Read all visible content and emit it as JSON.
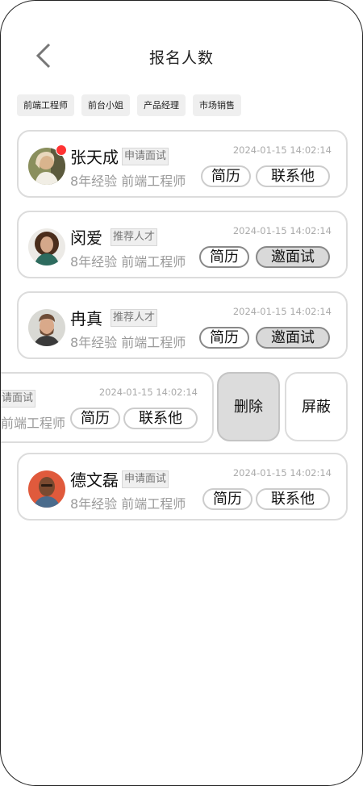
{
  "header": {
    "title": "报名人数"
  },
  "filters": [
    "前端工程师",
    "前台小姐",
    "产品经理",
    "市场销售"
  ],
  "candidates": [
    {
      "name": "张天成",
      "tag": "申请面试",
      "time": "2024-01-15 14:02:14",
      "meta": "8年经验  前端工程师",
      "btn1": "简历",
      "btn2": "联系他",
      "unread": true
    },
    {
      "name": "闵爱",
      "tag": "推荐人才",
      "time": "2024-01-15 14:02:14",
      "meta": "8年经验  前端工程师",
      "btn1": "简历",
      "btn2": "邀面试",
      "unread": false
    },
    {
      "name": "冉真",
      "tag": "推荐人才",
      "time": "2024-01-15 14:02:14",
      "meta": "8年经验  前端工程师",
      "btn1": "简历",
      "btn2": "邀面试",
      "unread": false
    },
    {
      "name": "",
      "tag": "请面试",
      "time": "2024-01-15 14:02:14",
      "meta": "前端工程师",
      "btn1": "简历",
      "btn2": "联系他",
      "unread": false
    },
    {
      "name": "德文磊",
      "tag": "申请面试",
      "time": "2024-01-15 14:02:14",
      "meta": "8年经验  前端工程师",
      "btn1": "简历",
      "btn2": "联系他",
      "unread": false
    }
  ],
  "swipe_actions": {
    "delete": "删除",
    "block": "屏蔽"
  },
  "colors": {
    "badge": "#ff3333",
    "card_border": "#dcdcdc",
    "action_delete_bg": "#dcdcdc"
  },
  "icons": {
    "back": "chevron-left-icon"
  }
}
